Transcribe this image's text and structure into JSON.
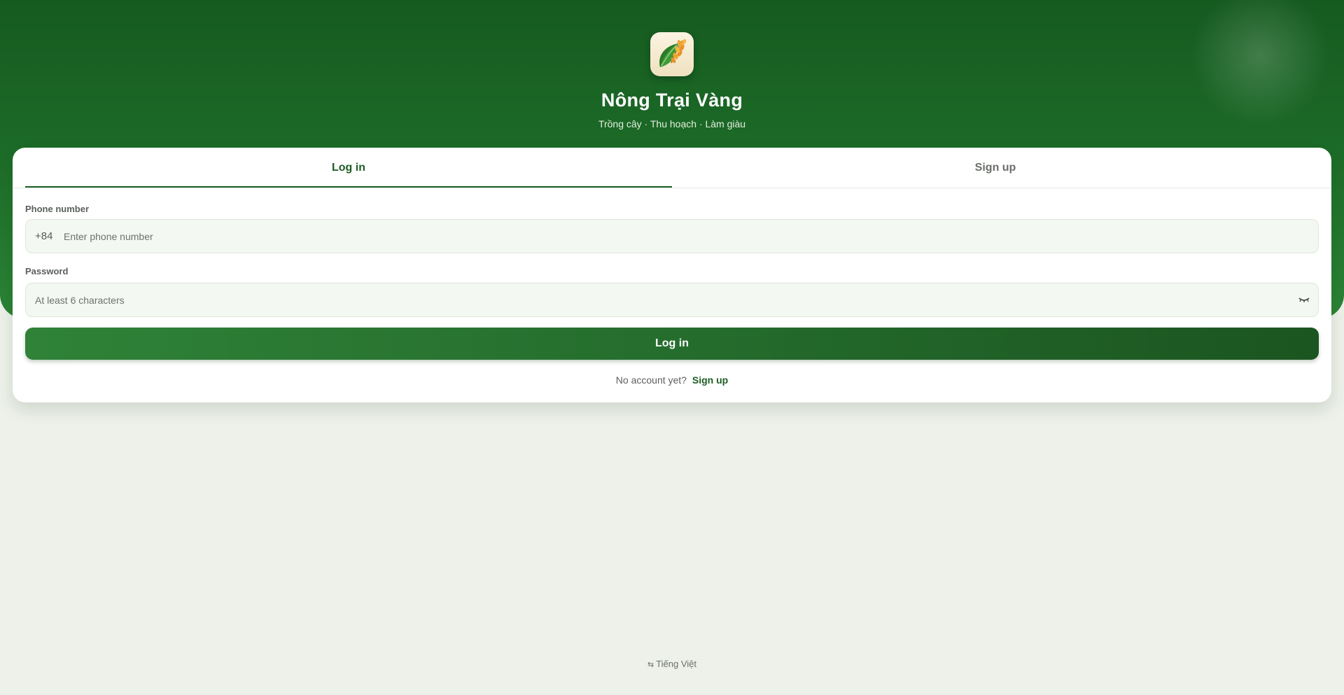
{
  "brand": {
    "name": "Nông Trại Vàng",
    "tagline": "Trồng cây · Thu hoạch · Làm giàu",
    "logo_icon": "rice-leaf-icon"
  },
  "tabs": [
    {
      "label": "Log in",
      "active": true
    },
    {
      "label": "Sign up",
      "active": false
    }
  ],
  "form": {
    "phone_label": "Phone number",
    "phone_prefix": "+84",
    "phone_placeholder": "Enter phone number",
    "phone_value": "",
    "password_label": "Password",
    "password_placeholder": "At least 6 characters",
    "password_value": "",
    "password_toggle_icon": "eye-closed-icon",
    "submit_label": "Log in"
  },
  "switch": {
    "text": "No account yet?",
    "link": "Sign up"
  },
  "language": {
    "icon": "swap-icon",
    "label": "Tiếng Việt"
  },
  "colors": {
    "brand_green": "#1d5d24",
    "hero_green": "#1c6a27",
    "background": "#edf1ea"
  }
}
